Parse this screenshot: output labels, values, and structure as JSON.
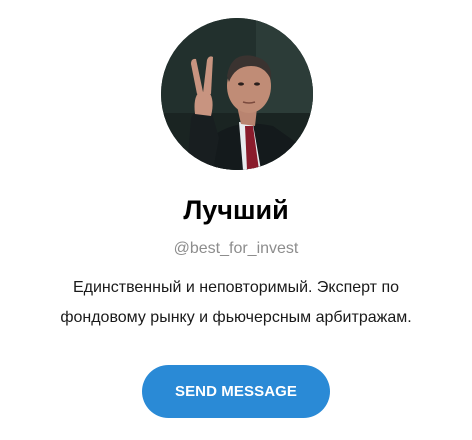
{
  "profile": {
    "name": "Лучший",
    "handle": "@best_for_invest",
    "bio_line1": "Единственный и неповторимый. Эксперт по",
    "bio_line2": "фондовому рынку и фьючерсным арбитражам.",
    "avatar_icon": "profile-photo"
  },
  "actions": {
    "send_message_label": "SEND MESSAGE"
  },
  "colors": {
    "button": "#2a8ad6",
    "handle_text": "#8d8d8d",
    "background": "#ffffff"
  }
}
